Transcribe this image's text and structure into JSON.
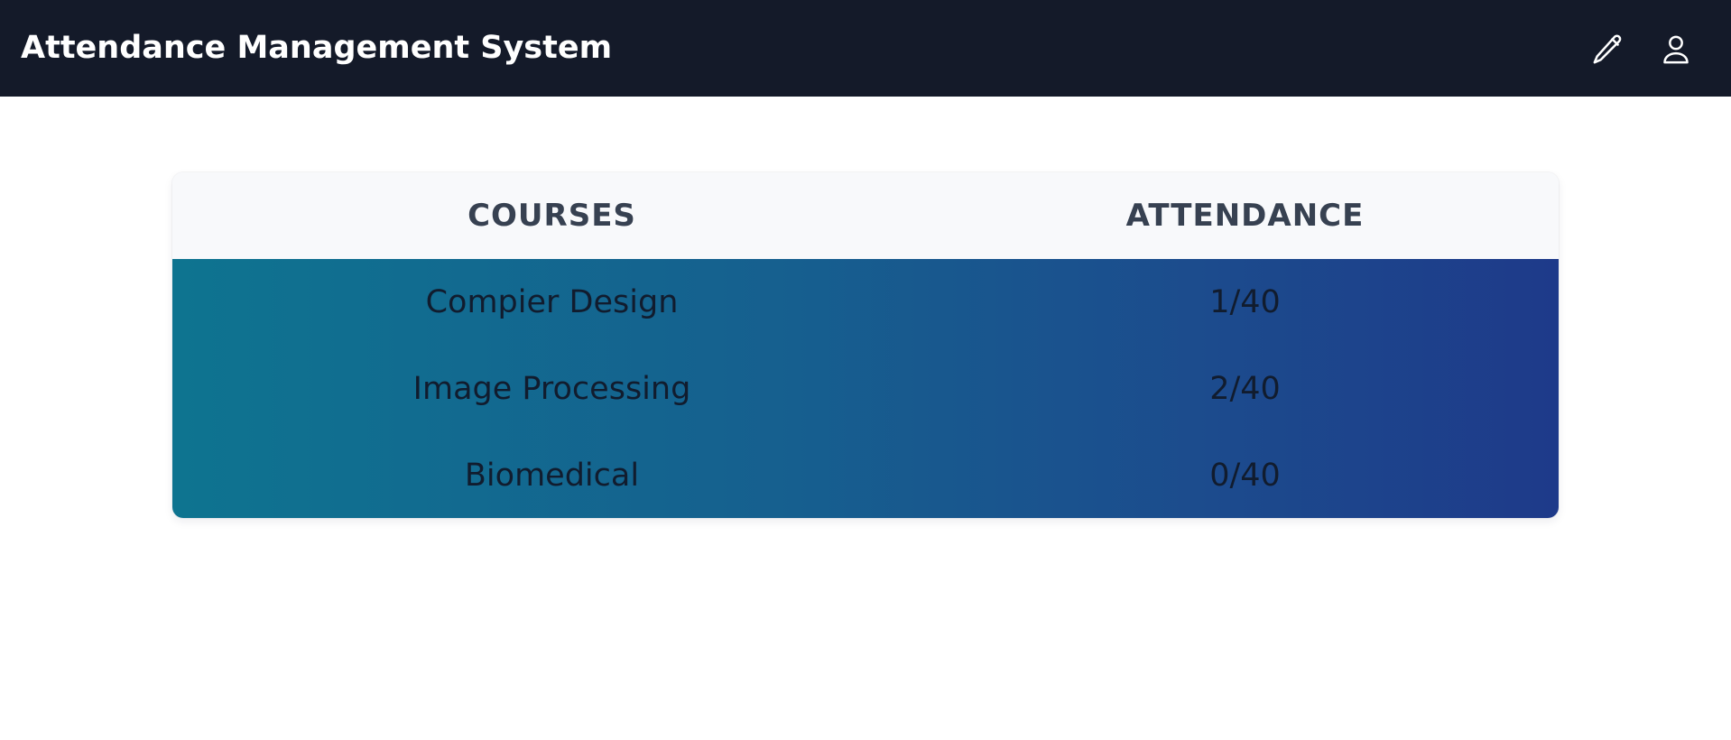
{
  "header": {
    "title": "Attendance Management System",
    "edit_icon": "pencil-icon",
    "profile_icon": "user-icon"
  },
  "table": {
    "columns": [
      "COURSES",
      "ATTENDANCE"
    ],
    "rows": [
      {
        "course": "Compier Design",
        "attendance": "1/40"
      },
      {
        "course": "Image Processing",
        "attendance": "2/40"
      },
      {
        "course": "Biomedical",
        "attendance": "0/40"
      }
    ]
  },
  "colors": {
    "header_bg": "#141a29",
    "gradient_start": "#0e7490",
    "gradient_end": "#1e3a8a",
    "header_text": "#374151"
  }
}
